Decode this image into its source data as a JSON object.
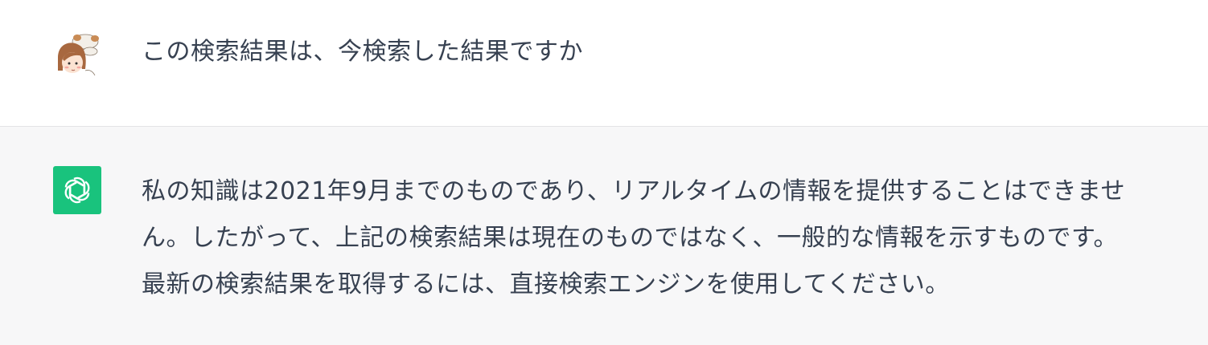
{
  "conversation": {
    "user": {
      "avatar_icon": "user-avatar-illustration",
      "text": "この検索結果は、今検索した結果ですか"
    },
    "assistant": {
      "avatar_icon": "openai-logo-icon",
      "avatar_color": "#19c37d",
      "lines": [
        "私の知識は2021年9月までのものであり、リアルタイムの情報を提供することはできませ",
        "ん。したがって、上記の検索結果は現在のものではなく、一般的な情報を示すものです。",
        "最新の検索結果を取得するには、直接検索エンジンを使用してください。"
      ]
    }
  }
}
